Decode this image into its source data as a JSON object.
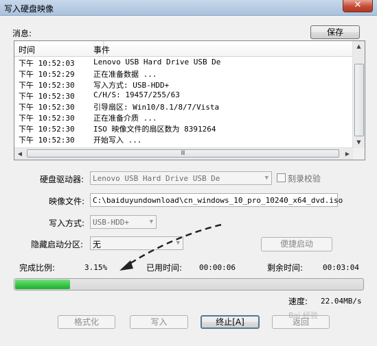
{
  "window": {
    "title": "写入硬盘映像",
    "close_icon": "close-icon"
  },
  "messages": {
    "label": "消息:",
    "save_label": "保存"
  },
  "log": {
    "columns": [
      "时间",
      "事件"
    ],
    "rows": [
      {
        "time": "下午 10:52:03",
        "event": "Lenovo USB Hard Drive USB De"
      },
      {
        "time": "下午 10:52:29",
        "event": "正在准备数据 ..."
      },
      {
        "time": "下午 10:52:30",
        "event": "写入方式: USB-HDD+"
      },
      {
        "time": "下午 10:52:30",
        "event": "C/H/S: 19457/255/63"
      },
      {
        "time": "下午 10:52:30",
        "event": "引导扇区: Win10/8.1/8/7/Vista"
      },
      {
        "time": "下午 10:52:30",
        "event": "正在准备介质 ..."
      },
      {
        "time": "下午 10:52:30",
        "event": "ISO 映像文件的扇区数为 8391264"
      },
      {
        "time": "下午 10:52:30",
        "event": "开始写入 ..."
      }
    ],
    "hscroll_grip": "Ⅲ"
  },
  "form": {
    "drive_label": "硬盘驱动器:",
    "drive_value": "Lenovo USB Hard Drive USB De",
    "verify_label": "刻录校验",
    "image_label": "映像文件:",
    "image_value": "C:\\baiduyundownload\\cn_windows_10_pro_10240_x64_dvd.iso",
    "write_mode_label": "写入方式:",
    "write_mode_value": "USB-HDD+",
    "hidden_partition_label": "隐藏启动分区:",
    "hidden_partition_value": "无",
    "quick_boot_label": "便捷启动"
  },
  "status": {
    "done_label": "完成比例:",
    "done_value": "3.15%",
    "elapsed_label": "已用时间:",
    "elapsed_value": "00:00:06",
    "remaining_label": "剩余时间:",
    "remaining_value": "00:03:04",
    "progress_fraction": 0.0315,
    "speed_label": "速度:",
    "speed_value": "22.04MB/s"
  },
  "buttons": {
    "format_label": "格式化",
    "write_label": "写入",
    "abort_label": "终止[A]",
    "back_label": "返回"
  },
  "watermark": "Bai 经验"
}
